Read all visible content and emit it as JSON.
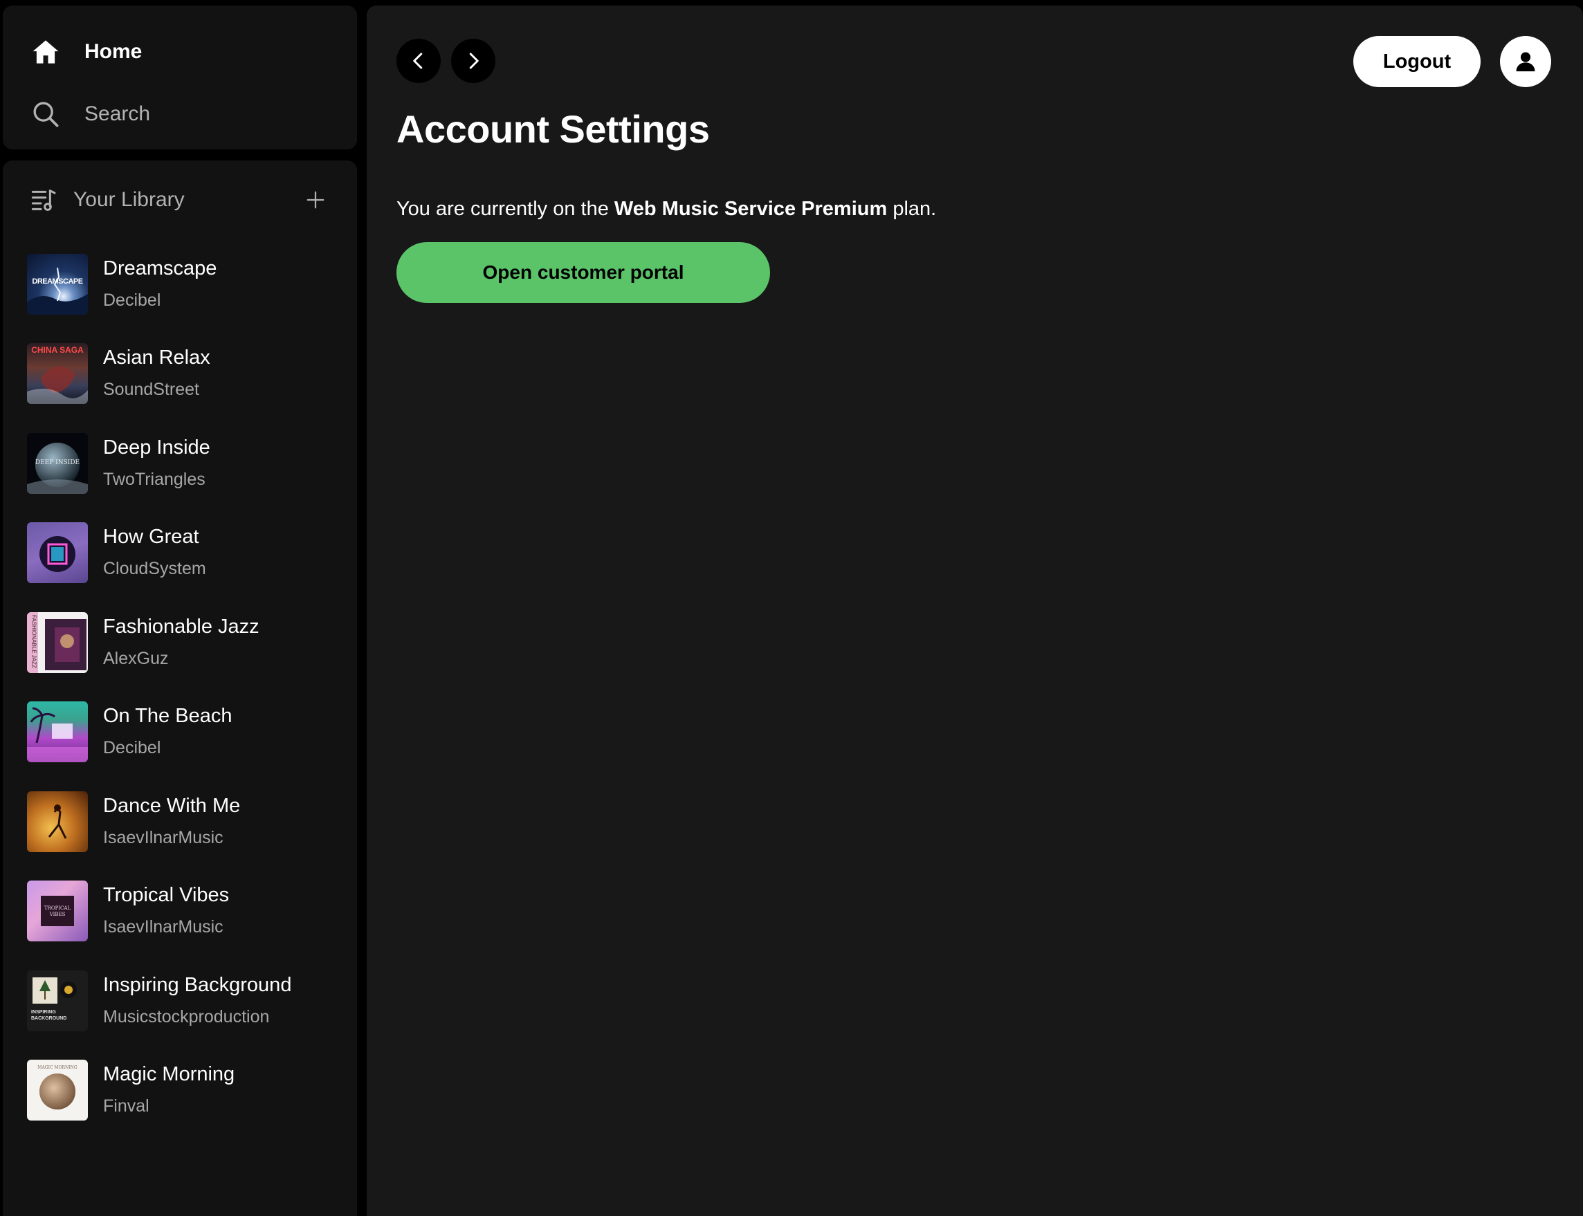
{
  "nav": {
    "home_label": "Home",
    "search_label": "Search"
  },
  "library": {
    "title": "Your Library",
    "items": [
      {
        "title": "Dreamscape",
        "artist": "Decibel",
        "cover_text": "DREAMSCAPE"
      },
      {
        "title": "Asian Relax",
        "artist": "SoundStreet",
        "cover_text": "CHINA SAGA"
      },
      {
        "title": "Deep Inside",
        "artist": "TwoTriangles",
        "cover_text": "DEEP INSIDE"
      },
      {
        "title": "How Great",
        "artist": "CloudSystem",
        "cover_text": ""
      },
      {
        "title": "Fashionable Jazz",
        "artist": "AlexGuz",
        "cover_text": "FASHIONABLE JAZZ"
      },
      {
        "title": "On The Beach",
        "artist": "Decibel",
        "cover_text": ""
      },
      {
        "title": "Dance With Me",
        "artist": "IsaevIlnarMusic",
        "cover_text": ""
      },
      {
        "title": "Tropical Vibes",
        "artist": "IsaevIlnarMusic",
        "cover_text": "TROPICAL VIBES"
      },
      {
        "title": "Inspiring Background",
        "artist": "Musicstockproduction",
        "cover_text": "INSPIRING BACKGROUND"
      },
      {
        "title": "Magic Morning",
        "artist": "Finval",
        "cover_text": "MAGIC MORNING"
      }
    ]
  },
  "header": {
    "logout_label": "Logout"
  },
  "main": {
    "title": "Account Settings",
    "plan_prefix": "You are currently on the ",
    "plan_name": "Web Music Service Premium",
    "plan_suffix": " plan.",
    "portal_button_label": "Open customer portal"
  },
  "colors": {
    "accent_green": "#5bc469",
    "panel_bg": "#121212",
    "main_bg": "#181818",
    "muted_text": "#a7a7a7"
  }
}
